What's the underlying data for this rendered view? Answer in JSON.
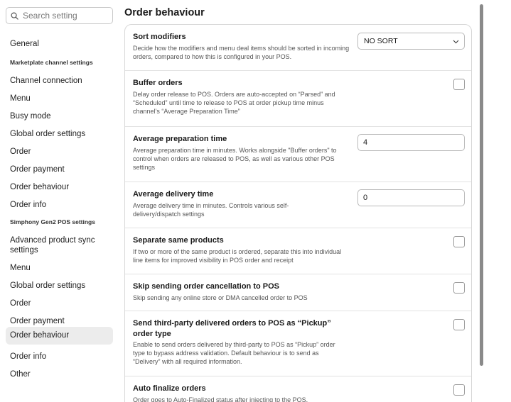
{
  "sidebar": {
    "search_placeholder": "Search setting",
    "general": "General",
    "marketplace_heading": "Marketplate channel settings",
    "marketplace_items": [
      "Channel connection",
      "Menu",
      "Busy mode",
      "Global order settings",
      "Order",
      "Order payment",
      "Order behaviour",
      "Order info"
    ],
    "pos_heading": "Simphony Gen2 POS settings",
    "pos_items": [
      "Advanced product sync settings",
      "Menu",
      "Global order settings",
      "Order",
      "Order payment",
      "Order behaviour",
      "Order info",
      "Other"
    ],
    "active_item": "Order behaviour"
  },
  "main": {
    "title": "Order behaviour",
    "settings": [
      {
        "title": "Sort modifiers",
        "desc": "Decide how the modifiers and menu deal items should be sorted in incoming orders, compared to how this is configured in your POS.",
        "control": "select",
        "value": "NO SORT"
      },
      {
        "title": "Buffer orders",
        "desc": "Delay order release to POS. Orders are auto-accepted on “Parsed” and “Scheduled” until time to release to POS at order pickup time minus channel’s “Average Preparation Time”",
        "control": "checkbox",
        "checked": false
      },
      {
        "title": "Average preparation time",
        "desc": "Average preparation time in minutes. Works alongside \"Buffer orders\" to control when orders are released to POS, as well as various other POS settings",
        "control": "input",
        "value": "4"
      },
      {
        "title": "Average delivery time",
        "desc": "Average delivery time in minutes. Controls various self-delivery/dispatch settings",
        "control": "input",
        "value": "0"
      },
      {
        "title": "Separate same products",
        "desc": "If two or more of the same product is ordered, separate this into individual line items for improved visibility in POS order and receipt",
        "control": "checkbox",
        "checked": false
      },
      {
        "title": "Skip sending order cancellation to POS",
        "desc": "Skip sending any online store or DMA cancelled order to POS",
        "control": "checkbox",
        "checked": false
      },
      {
        "title": "Send third-party delivered orders to POS as “Pickup” order type",
        "desc": "Enable to send orders delivered by third-party to POS as “Pickup” order type to bypass address validation. Default behaviour is to send as “Delivery” with all required information.",
        "control": "checkbox",
        "checked": false
      },
      {
        "title": "Auto finalize orders",
        "desc": "Order goes to Auto-Finalized status after injecting to the POS.",
        "control": "checkbox",
        "checked": false
      }
    ]
  },
  "icons": {
    "search": "search-icon",
    "dropdown": "chevron-down-icon"
  }
}
